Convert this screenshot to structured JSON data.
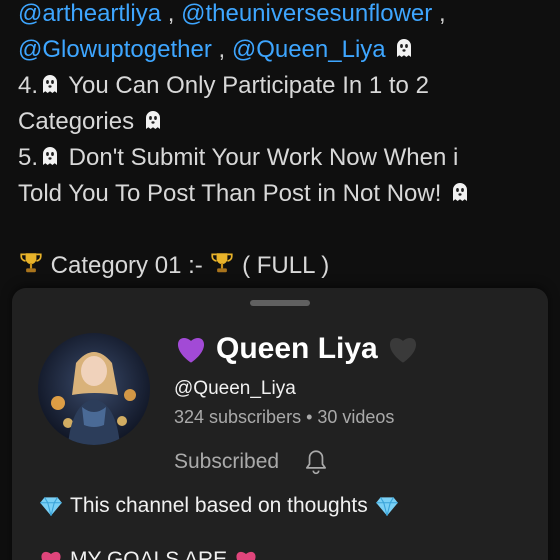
{
  "post": {
    "line1": {
      "mentions": [
        "@artheartliya",
        "@theuniversesunflower"
      ],
      "sep1": ",",
      "sep2": ","
    },
    "line2": {
      "mentions": [
        "@Glowuptogether",
        "@Queen_Liya"
      ],
      "sep": ","
    },
    "rule4_a": "4.",
    "rule4_b": " You Can Only Participate In 1 to 2",
    "rule4_c": "Categories ",
    "rule5_a": "5.",
    "rule5_b": " Don't Submit Your Work Now When i",
    "rule5_c": "Told You To Post Than Post in Not Now! ",
    "category_a": " Category 01 :- ",
    "category_b": " ( FULL )"
  },
  "sheet": {
    "channel_name": "Queen Liya",
    "handle": "@Queen_Liya",
    "stats": "324 subscribers • 30 videos",
    "subscribed_label": "Subscribed",
    "description": "This channel based on thoughts",
    "description2": "MY GOALS ARE"
  },
  "colors": {
    "mention": "#3ea6ff",
    "background": "#0f0f0f",
    "sheet": "#212121",
    "purple_heart": "#a24ad6",
    "black_heart": "#3a3a3a"
  },
  "icons": [
    "ghost-icon",
    "trophy-icon",
    "purple-heart-icon",
    "black-heart-icon",
    "bell-icon",
    "diamond-icon",
    "pink-heart-icon"
  ]
}
